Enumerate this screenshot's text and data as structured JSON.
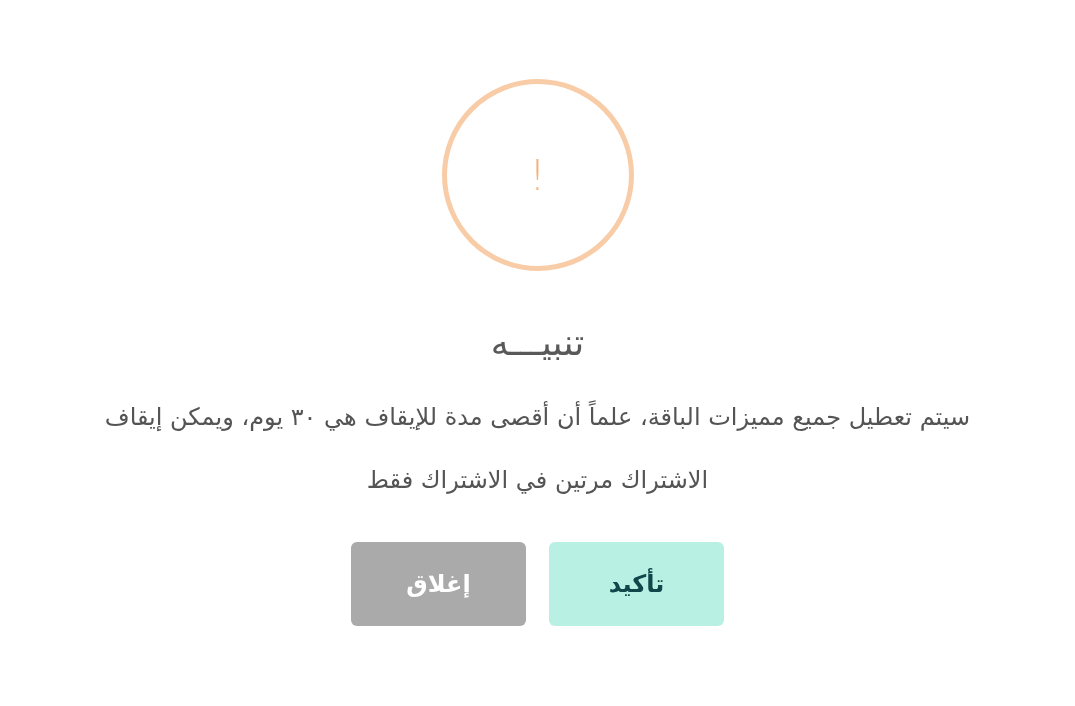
{
  "dialog": {
    "icon": "!",
    "title": "تنبيـــه",
    "message": "سيتم تعطيل جميع مميزات الباقة، علماً أن أقصى مدة للإيقاف هي ٣٠ يوم، ويمكن إيقاف الاشتراك مرتين في الاشتراك فقط",
    "buttons": [
      {
        "label": "تأكيد",
        "kind": "confirm"
      },
      {
        "label": "إغلاق",
        "kind": "cancel"
      }
    ]
  }
}
